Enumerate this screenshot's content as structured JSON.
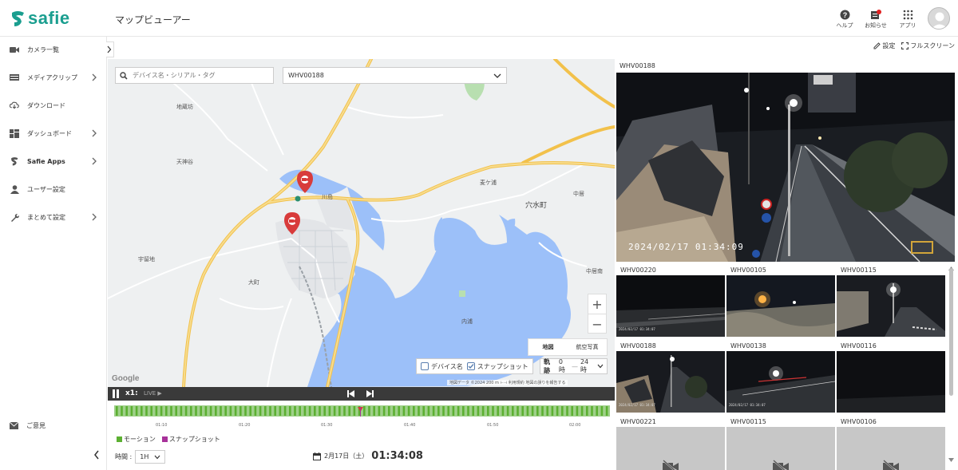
{
  "app": {
    "logo": "safie",
    "page_title": "マップビューアー"
  },
  "header": {
    "help": "ヘルプ",
    "notice": "お知らせ",
    "apps": "アプリ"
  },
  "sidebar": {
    "items": [
      {
        "label": "カメラ一覧",
        "icon": "video-camera-icon"
      },
      {
        "label": "メディアクリップ",
        "icon": "film-icon"
      },
      {
        "label": "ダウンロード",
        "icon": "cloud-download-icon"
      },
      {
        "label": "ダッシュボード",
        "icon": "dashboard-icon"
      },
      {
        "label": "Safie Apps",
        "icon": "safie-apps-icon"
      },
      {
        "label": "ユーザー設定",
        "icon": "user-icon"
      },
      {
        "label": "まとめて設定",
        "icon": "wrench-icon"
      }
    ],
    "feedback": "ご意見"
  },
  "toolbar": {
    "settings": "設定",
    "fullscreen": "フルスクリーン"
  },
  "map": {
    "search_placeholder": "デバイス名・シリアル・タグ",
    "selected_device": "WHV00188",
    "map_type": [
      "地図",
      "航空写真"
    ],
    "active_map_type": "地図",
    "opt_device_name": "デバイス名",
    "opt_snapshot": "スナップショット",
    "track_label": "軌跡",
    "track_from": "0時",
    "track_sep": "—",
    "track_to": "24時",
    "google": "Google",
    "attribution": "地図データ ©2024  200 m ⊢⊣  利用規約  地図の誤りを報告する",
    "places": [
      "地蔵坊",
      "天神谷",
      "宇留地",
      "大町",
      "川島",
      "麦ケ浦",
      "中居",
      "穴水町",
      "中居南",
      "内浦"
    ],
    "zoom_in": "+",
    "zoom_out": "−"
  },
  "playback": {
    "speed": "x1:",
    "live": "LIVE ▶",
    "timeline_labels": [
      "01:10",
      "01:20",
      "01:30",
      "01:40",
      "01:50",
      "02:00"
    ],
    "legend_motion": "モーション",
    "legend_snapshot": "スナップショット",
    "time_label": "時間 :",
    "time_value": "1H",
    "date": "2月17日（土）",
    "clock": "01:34:08",
    "colors": {
      "motion": "#5cb032",
      "snapshot": "#a8329a",
      "track": "#9fd08a"
    }
  },
  "cameras": {
    "main": {
      "name": "WHV00188",
      "timestamp": "2024/02/17 01:34:09"
    },
    "grid": [
      {
        "name": "WHV00220",
        "status": "live",
        "ts": "2024/02/17 01:34:07"
      },
      {
        "name": "WHV00105",
        "status": "live",
        "ts": ""
      },
      {
        "name": "WHV00115",
        "status": "live",
        "ts": ""
      },
      {
        "name": "WHV00188",
        "status": "live",
        "ts": "2024/02/17 01:34:07"
      },
      {
        "name": "WHV00138",
        "status": "live",
        "ts": "2024/02/17 01:34:07"
      },
      {
        "name": "WHV00116",
        "status": "live",
        "ts": ""
      },
      {
        "name": "WHV00221",
        "status": "offline",
        "ts": ""
      },
      {
        "name": "WHV00115",
        "status": "offline",
        "ts": ""
      },
      {
        "name": "WHV00106",
        "status": "offline",
        "ts": ""
      }
    ]
  }
}
